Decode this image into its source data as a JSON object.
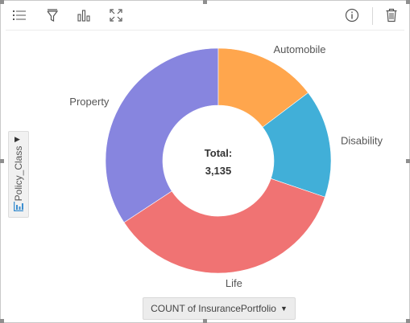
{
  "toolbar": {
    "icons": [
      "legend-list-icon",
      "filter-icon",
      "bar-chart-icon",
      "expand-icon",
      "info-icon",
      "trash-icon"
    ]
  },
  "side_dropdown": {
    "label": "Policy_Class",
    "icon": "chart-axis-icon"
  },
  "bottom_dropdown": {
    "label": "COUNT of InsurancePortfolio"
  },
  "chart_data": {
    "type": "pie",
    "variant": "donut",
    "center_label": "Total:",
    "total_text": "3,135",
    "total": 3135,
    "slices": [
      {
        "label": "Property",
        "value": 1074,
        "color": "#8785DF"
      },
      {
        "label": "Automobile",
        "value": 460,
        "color": "#FFA64D"
      },
      {
        "label": "Disability",
        "value": 488,
        "color": "#41AFD8"
      },
      {
        "label": "Life",
        "value": 1113,
        "color": "#F07373"
      }
    ]
  }
}
